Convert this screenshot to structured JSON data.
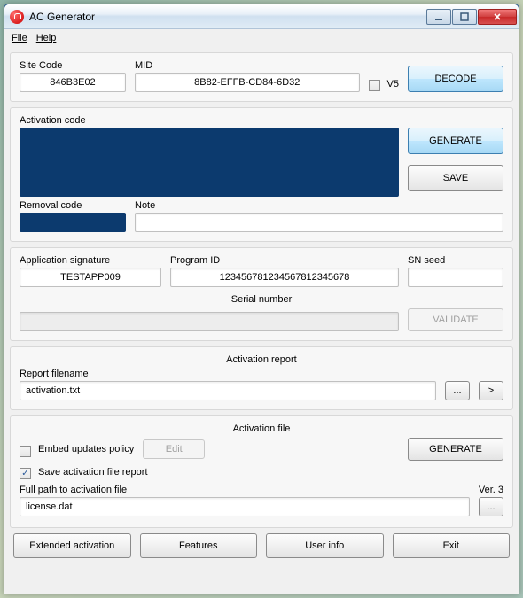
{
  "window": {
    "title": "AC Generator"
  },
  "menu": {
    "file": "File",
    "help": "Help"
  },
  "top": {
    "site_code_label": "Site Code",
    "site_code": "846B3E02",
    "mid_label": "MID",
    "mid": "8B82-EFFB-CD84-6D32",
    "v5_label": "V5",
    "decode": "DECODE"
  },
  "act": {
    "code_label": "Activation code",
    "generate": "GENERATE",
    "save": "SAVE",
    "removal_label": "Removal code",
    "note_label": "Note"
  },
  "sig": {
    "app_sig_label": "Application signature",
    "app_sig": "TESTAPP009",
    "program_id_label": "Program ID",
    "program_id": "123456781234567812345678",
    "sn_seed_label": "SN seed",
    "serial_label": "Serial number",
    "validate": "VALIDATE"
  },
  "report": {
    "title": "Activation report",
    "filename_label": "Report filename",
    "filename": "activation.txt",
    "browse": "...",
    "go": ">"
  },
  "file": {
    "title": "Activation file",
    "embed_label": "Embed updates policy",
    "edit": "Edit",
    "generate": "GENERATE",
    "savereport_label": "Save activation file report",
    "version": "Ver. 3",
    "fullpath_label": "Full path to activation file",
    "fullpath": "license.dat",
    "browse": "..."
  },
  "bottom": {
    "extended": "Extended activation",
    "features": "Features",
    "userinfo": "User info",
    "exit": "Exit"
  }
}
